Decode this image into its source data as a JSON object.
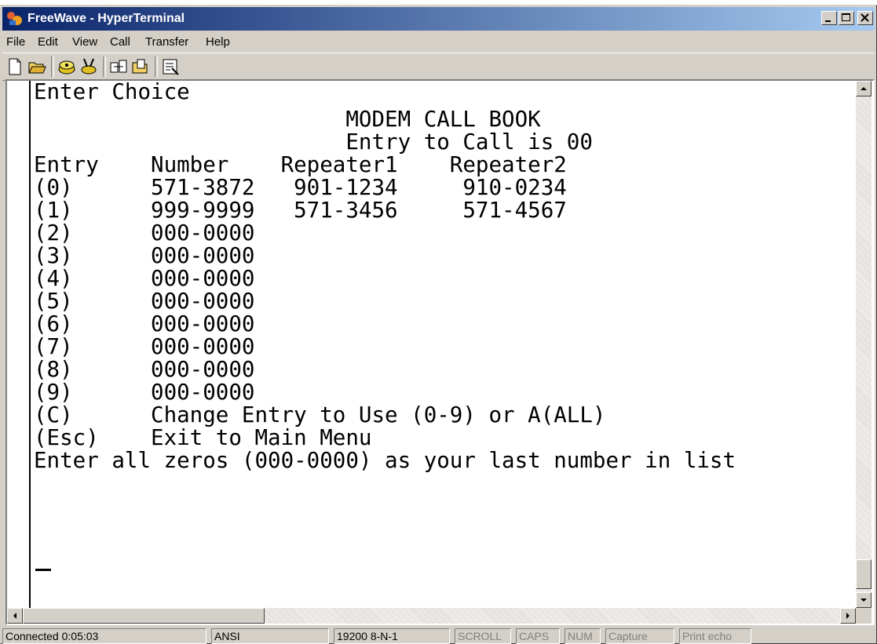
{
  "window": {
    "title": "FreeWave - HyperTerminal",
    "controls": {
      "minimize": "_",
      "maximize": "□",
      "close": "✕"
    }
  },
  "menu": [
    "File",
    "Edit",
    "View",
    "Call",
    "Transfer",
    "Help"
  ],
  "toolbar": [
    "new-connection-icon",
    "open-icon",
    "connect-icon",
    "disconnect-icon",
    "send-icon",
    "receive-icon",
    "properties-icon"
  ],
  "terminal": {
    "lines": [
      "Enter Choice",
      "                        MODEM CALL BOOK",
      "                        Entry to Call is 00",
      "Entry    Number    Repeater1    Repeater2",
      "(0)      571-3872   901-1234     910-0234",
      "(1)      999-9999   571-3456     571-4567",
      "(2)      000-0000",
      "(3)      000-0000",
      "(4)      000-0000",
      "(5)      000-0000",
      "(6)      000-0000",
      "(7)      000-0000",
      "(8)      000-0000",
      "(9)      000-0000",
      "(C)      Change Entry to Use (0-9) or A(ALL)",
      "(Esc)    Exit to Main Menu",
      "Enter all zeros (000-0000) as your last number in list"
    ],
    "cursor": "_"
  },
  "status": {
    "connected": "Connected 0:05:03",
    "emulation": "ANSI",
    "settings": "19200 8-N-1",
    "scroll": "SCROLL",
    "caps": "CAPS",
    "num": "NUM",
    "capture": "Capture",
    "print_echo": "Print echo"
  }
}
